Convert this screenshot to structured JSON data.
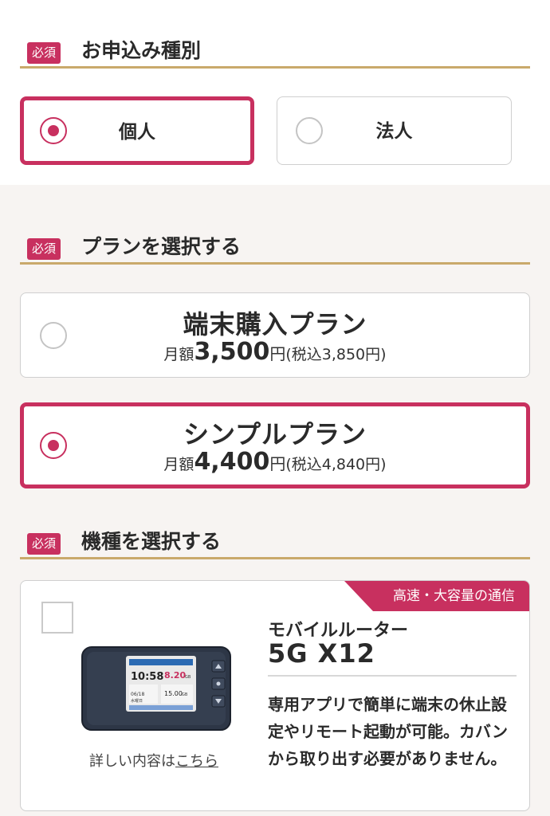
{
  "required_badge": "必須",
  "sections": {
    "type": {
      "title": "お申込み種別",
      "options": [
        "個人",
        "法人"
      ],
      "selected": "個人"
    },
    "plan": {
      "title": "プランを選択する",
      "options": [
        {
          "name": "端末購入プラン",
          "prefix": "月額",
          "price": "3,500",
          "yen": "円",
          "tax": "(税込3,850円)"
        },
        {
          "name": "シンプルプラン",
          "prefix": "月額",
          "price": "4,400",
          "yen": "円",
          "tax": "(税込4,840円)"
        }
      ],
      "selected": "シンプルプラン"
    },
    "device": {
      "title": "機種を選択する",
      "tag": "高速・大容量の通信",
      "subtitle": "モバイルルーター",
      "model": "5G X12",
      "description": "専用アプリで簡単に端末の休止設定やリモート起動が可能。カバンから取り出す必要がありません。",
      "details_prefix": "詳しい内容は",
      "details_link": "こちら",
      "screen": {
        "time": "10:58",
        "date_line": "06/18",
        "day": "水曜日",
        "data": "8.20",
        "data_unit": "GB",
        "limit": "15.00",
        "limit_unit": "GB"
      }
    }
  },
  "colors": {
    "accent": "#c8305f",
    "gold": "#c9a96b"
  }
}
